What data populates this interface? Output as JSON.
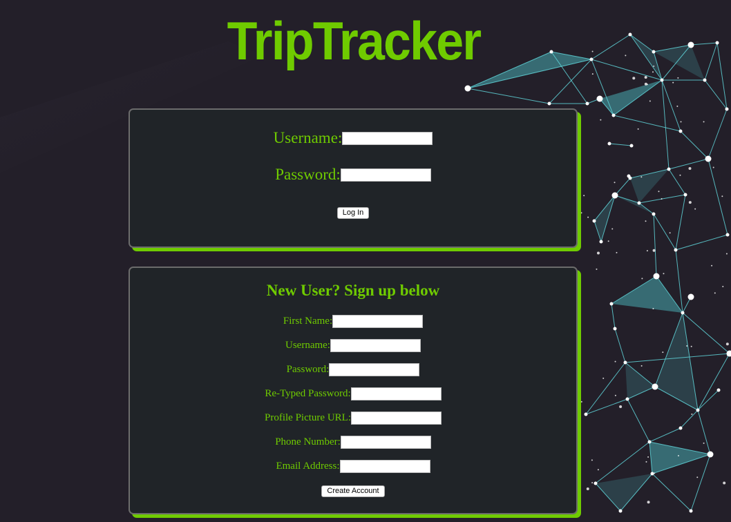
{
  "app": {
    "title": "TripTracker"
  },
  "login": {
    "username_label": "Username:",
    "username_value": "",
    "password_label": "Password:",
    "password_value": "",
    "login_button": "Log In"
  },
  "signup": {
    "heading": "New User? Sign up below",
    "fields": [
      {
        "label": "First Name:",
        "value": ""
      },
      {
        "label": "Username:",
        "value": ""
      },
      {
        "label": "Password:",
        "value": ""
      },
      {
        "label": "Re-Typed Password:",
        "value": ""
      },
      {
        "label": "Profile Picture URL:",
        "value": ""
      },
      {
        "label": "Phone Number:",
        "value": ""
      },
      {
        "label": "Email Address:",
        "value": ""
      }
    ],
    "create_button": "Create Account"
  },
  "colors": {
    "accent": "#6fcb00",
    "background": "#231f29",
    "panel": "#202428",
    "network": "#5fd3d8"
  },
  "background_image": "network-mesh-graphic"
}
